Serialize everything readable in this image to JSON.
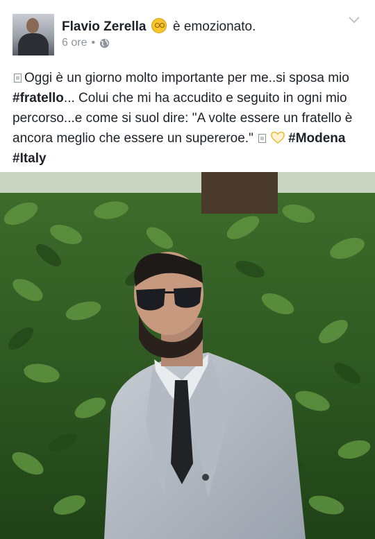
{
  "post": {
    "author": {
      "name": "Flavio Zerella",
      "feeling_icon": "star-struck-emoji-icon",
      "feeling": "è emozionato."
    },
    "timestamp": "6 ore",
    "separator": "•",
    "privacy_icon": "globe-icon",
    "options_icon": "chevron-down-icon",
    "text": {
      "part1": "Oggi è un giorno molto importante per me..si sposa mio ",
      "hashtag1": "#fratello",
      "part2": "... Colui che mi ha accudito e seguito in ogni mio percorso...e come si suol dire: \"A volte essere un fratello è ancora meglio che essere un supereroe.\" ",
      "hashtag2": "#Modena",
      "hashtag3": "#Italy"
    },
    "colors": {
      "text": "#1d2129",
      "meta": "#90949c",
      "heart": "#f5d06b"
    },
    "photo_subject": "man in grey suit and aviator sunglasses in front of a hedge"
  }
}
